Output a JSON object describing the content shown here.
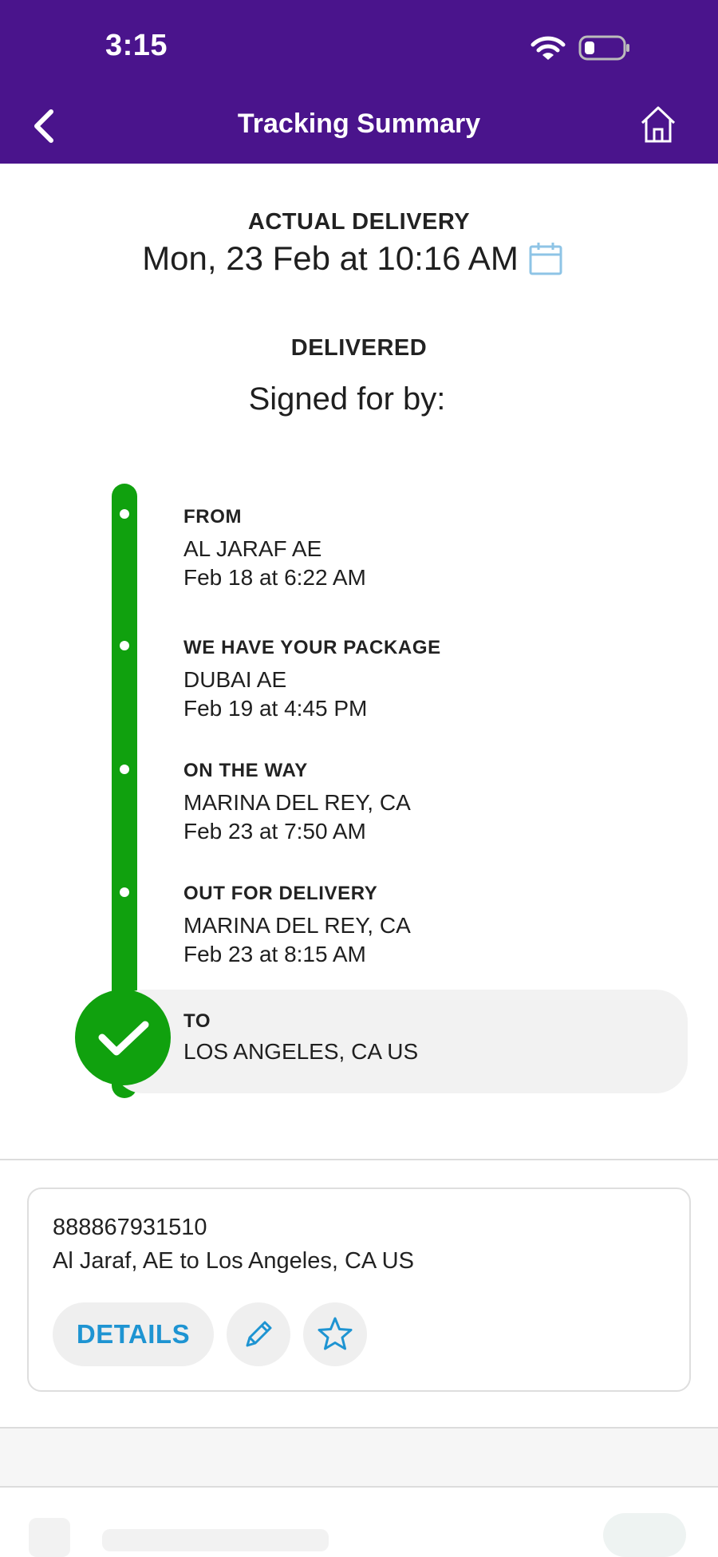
{
  "status_bar": {
    "time": "3:15"
  },
  "header": {
    "title": "Tracking Summary"
  },
  "delivery": {
    "label": "ACTUAL DELIVERY",
    "date": "Mon, 23 Feb at 10:16 AM",
    "status": "DELIVERED",
    "signed_for": "Signed for by: "
  },
  "timeline": [
    {
      "title": "FROM",
      "line1": "AL JARAF AE",
      "line2": "Feb 18 at 6:22 AM"
    },
    {
      "title": "WE HAVE YOUR PACKAGE",
      "line1": "DUBAI AE",
      "line2": "Feb 19 at 4:45 PM"
    },
    {
      "title": "ON THE WAY",
      "line1": "MARINA DEL REY, CA",
      "line2": "Feb 23 at 7:50 AM"
    },
    {
      "title": "OUT FOR DELIVERY",
      "line1": "MARINA DEL REY, CA",
      "line2": "Feb 23 at 8:15 AM"
    },
    {
      "title": "TO",
      "line1": "LOS ANGELES, CA  US"
    }
  ],
  "package": {
    "tracking_number": "888867931510",
    "route": "Al Jaraf, AE to Los Angeles, CA US",
    "details_label": "DETAILS"
  },
  "colors": {
    "header_bg": "#4a148c",
    "progress_green": "#10a10e",
    "link_blue": "#1e94d2"
  },
  "icons": [
    "back-arrow-icon",
    "home-icon",
    "calendar-icon",
    "checkmark-icon",
    "pencil-icon",
    "star-icon",
    "wifi-icon",
    "battery-icon"
  ]
}
